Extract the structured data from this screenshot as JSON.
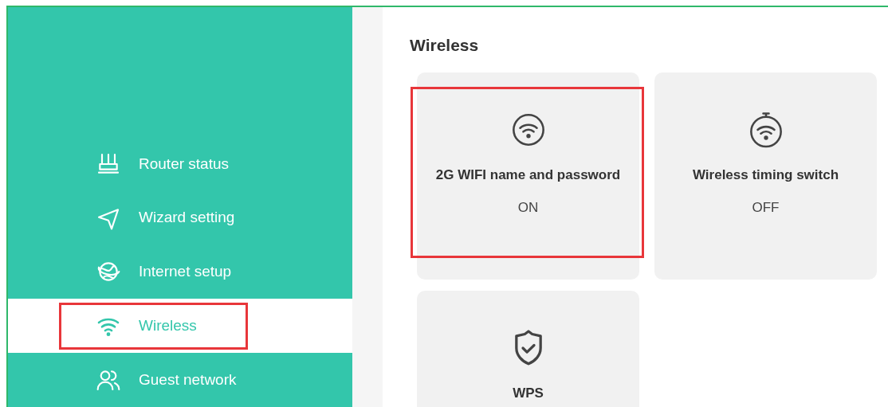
{
  "sidebar": {
    "items": [
      {
        "label": "Router status",
        "selected": false,
        "highlighted": false
      },
      {
        "label": "Wizard setting",
        "selected": false,
        "highlighted": false
      },
      {
        "label": "Internet setup",
        "selected": false,
        "highlighted": false
      },
      {
        "label": "Wireless",
        "selected": true,
        "highlighted": true
      },
      {
        "label": "Guest network",
        "selected": false,
        "highlighted": false
      }
    ]
  },
  "content": {
    "title": "Wireless",
    "cards": [
      {
        "title": "2G WIFI name and password",
        "status": "ON",
        "highlighted": true
      },
      {
        "title": "Wireless timing switch",
        "status": "OFF",
        "highlighted": false
      },
      {
        "title": "WPS",
        "highlighted": false
      }
    ]
  }
}
